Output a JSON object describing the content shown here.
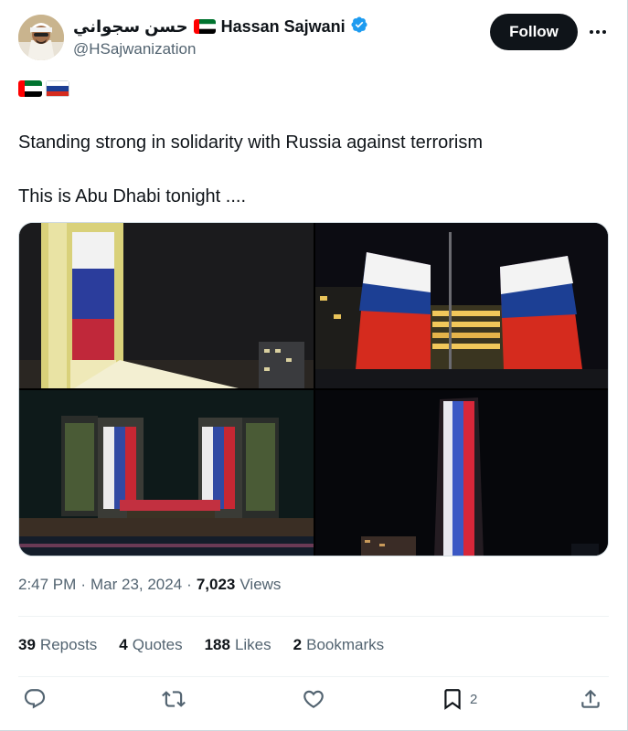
{
  "user": {
    "arabic_name": "حسن سجواني",
    "display_name": "Hassan Sajwani",
    "handle": "@HSajwanization",
    "verified": true
  },
  "buttons": {
    "follow_label": "Follow"
  },
  "icons": {
    "more": "more-horizontal-icon",
    "verified": "verified-badge-icon",
    "reply": "reply-icon",
    "repost": "repost-icon",
    "like": "heart-icon",
    "bookmark": "bookmark-icon",
    "share": "share-icon"
  },
  "tweet": {
    "flags": [
      "UAE",
      "Russia"
    ],
    "line1": "Standing strong in solidarity with Russia against terrorism",
    "line2": "This is Abu Dhabi tonight ...."
  },
  "meta": {
    "time": "2:47 PM",
    "separator": "·",
    "date": "Mar 23, 2024",
    "views_count": "7,023",
    "views_label": "Views"
  },
  "stats": {
    "reposts_count": "39",
    "reposts_label": "Reposts",
    "quotes_count": "4",
    "quotes_label": "Quotes",
    "likes_count": "188",
    "likes_label": "Likes",
    "bookmarks_count": "2",
    "bookmarks_label": "Bookmarks"
  },
  "actions": {
    "bookmark_count": "2"
  },
  "colors": {
    "text": "#0f1419",
    "secondary": "#536471",
    "verified": "#1d9bf0",
    "divider": "#eff3f4",
    "russia_white": "#ffffff",
    "russia_blue": "#1c3f94",
    "russia_red": "#d52b1e",
    "uae_green": "#00732f",
    "uae_red": "#ff0000"
  }
}
